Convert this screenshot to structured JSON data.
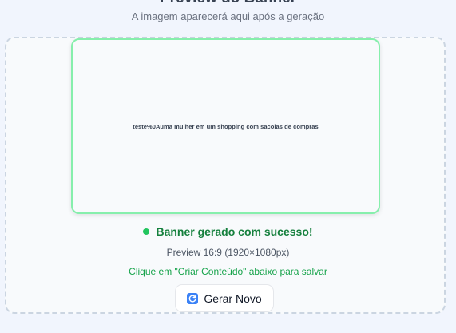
{
  "header": {
    "title": "Preview do Banner",
    "subtitle": "A imagem aparecerá aqui após a geração"
  },
  "preview": {
    "image_text": "teste%0Auma mulher em um shopping com sacolas de compras"
  },
  "status": {
    "message": "Banner gerado com sucesso!",
    "dimensions": "Preview 16:9 (1920×1080px)",
    "hint": "Clique em \"Criar Conteúdo\" abaixo para salvar"
  },
  "actions": {
    "regenerate_label": "Gerar Novo",
    "regenerate_icon": "refresh-icon"
  },
  "colors": {
    "success": "#15803d",
    "success_dot": "#22c55e",
    "frame_border": "#86efac",
    "icon_bg": "#3b82f6"
  }
}
